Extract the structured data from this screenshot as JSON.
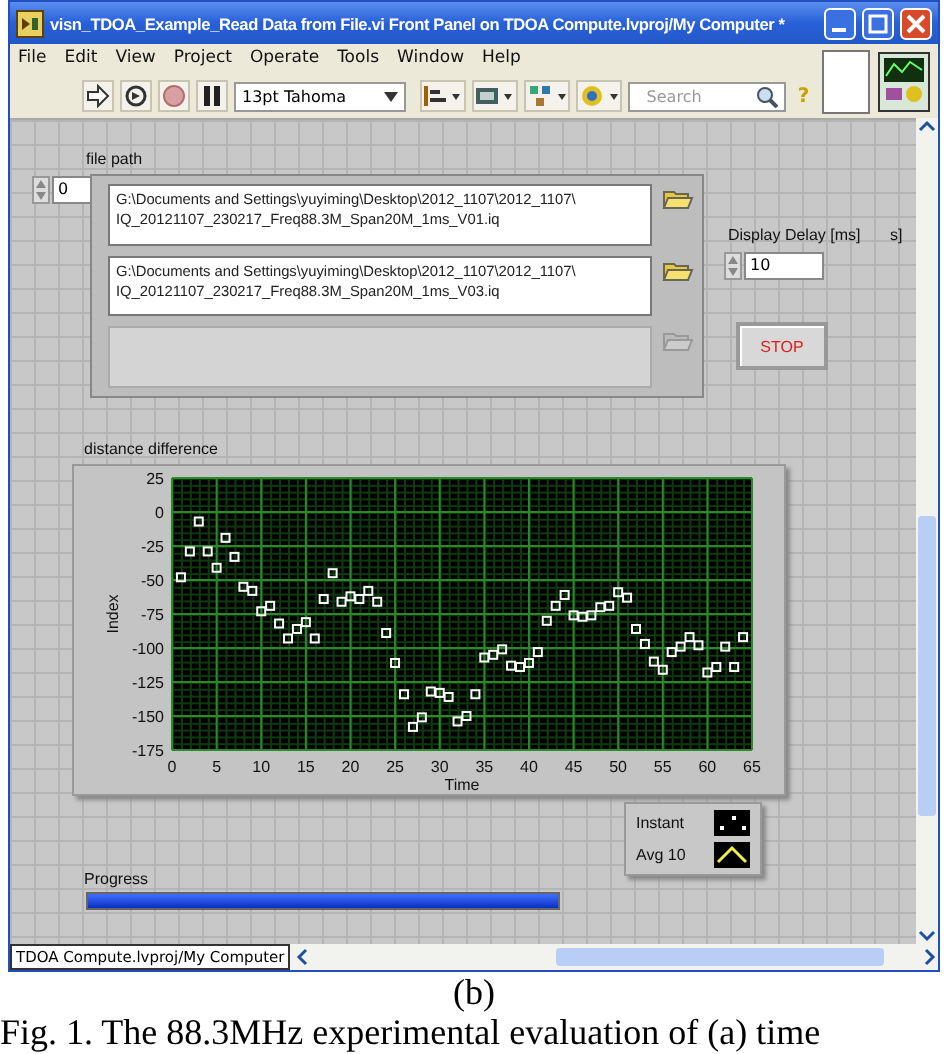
{
  "window": {
    "title": "visn_TDOA_Example_Read Data from File.vi Front Panel on TDOA Compute.lvproj/My Computer *"
  },
  "menu": [
    "File",
    "Edit",
    "View",
    "Project",
    "Operate",
    "Tools",
    "Window",
    "Help"
  ],
  "toolbar": {
    "font": "13pt Tahoma",
    "search": {
      "placeholder": "Search"
    },
    "help": "?"
  },
  "panel": {
    "file_path": {
      "label": "file path",
      "index": "0",
      "paths": [
        {
          "lines": [
            "G:\\Documents and Settings\\yuyiming\\Desktop\\2012_1107\\2012_1107\\",
            "IQ_20121107_230217_Freq88.3M_Span20M_1ms_V01.iq"
          ],
          "disabled": false
        },
        {
          "lines": [
            "G:\\Documents and Settings\\yuyiming\\Desktop\\2012_1107\\2012_1107\\",
            "IQ_20121107_230217_Freq88.3M_Span20M_1ms_V03.iq"
          ],
          "disabled": false
        },
        {
          "disabled": true
        }
      ]
    },
    "display_delay": {
      "label": "Display Delay [ms]",
      "label_fragment": "s]",
      "value": "10"
    },
    "stop_button": "STOP",
    "graph": {
      "label": "distance difference",
      "chart_data": {
        "type": "scatter",
        "xlabel": "Time",
        "ylabel": "Index",
        "x": [
          1,
          2,
          3,
          4,
          5,
          6,
          7,
          8,
          9,
          10,
          11,
          12,
          13,
          14,
          15,
          16,
          17,
          18,
          19,
          20,
          21,
          22,
          23,
          24,
          25,
          26,
          27,
          28,
          29,
          30,
          31,
          32,
          33,
          34,
          35,
          36,
          37,
          38,
          39,
          40,
          41,
          42,
          43,
          44,
          45,
          46,
          47,
          48,
          49,
          50,
          51,
          52,
          53,
          54,
          55,
          56,
          57,
          58,
          59,
          60,
          61,
          62,
          63,
          64
        ],
        "grid": true,
        "series": [
          {
            "color": "#ffffff",
            "values": [
              -48,
              -29,
              -7,
              -29,
              -41,
              -19,
              -33,
              -55,
              -58,
              -73,
              -69,
              -82,
              -93,
              -86,
              -81,
              -93,
              -64,
              -45,
              -66,
              -62,
              -64,
              -58,
              -66,
              -89,
              -111,
              -134,
              -158,
              -151,
              -132,
              -133,
              -136,
              -154,
              -150,
              -134,
              -107,
              -105,
              -101,
              -113,
              -114,
              -111,
              -103,
              -80,
              -69,
              -61,
              -76,
              -77,
              -76,
              -70,
              -69,
              -59,
              -63,
              -86,
              -97,
              -110,
              -116,
              -103,
              -99,
              -92,
              -98,
              -118,
              -114,
              -99,
              -114,
              -92
            ]
          }
        ],
        "xlim": [
          0,
          65
        ],
        "ylim": [
          -175,
          25
        ],
        "xticks": [
          0,
          5,
          10,
          15,
          20,
          25,
          30,
          35,
          40,
          45,
          50,
          55,
          60,
          65
        ],
        "yticks": [
          25,
          0,
          -25,
          -50,
          -75,
          -100,
          -125,
          -150,
          -175
        ]
      }
    },
    "legend": [
      {
        "name": "Instant",
        "kind": "points"
      },
      {
        "name": "Avg 10",
        "kind": "line"
      }
    ],
    "progress": {
      "label": "Progress",
      "level": 1
    }
  },
  "status_bar": {
    "context": "TDOA Compute.lvproj/My Computer"
  },
  "caption": "(b)",
  "figure_caption": "Fig. 1. The 88.3MHz experimental evaluation of (a) time"
}
